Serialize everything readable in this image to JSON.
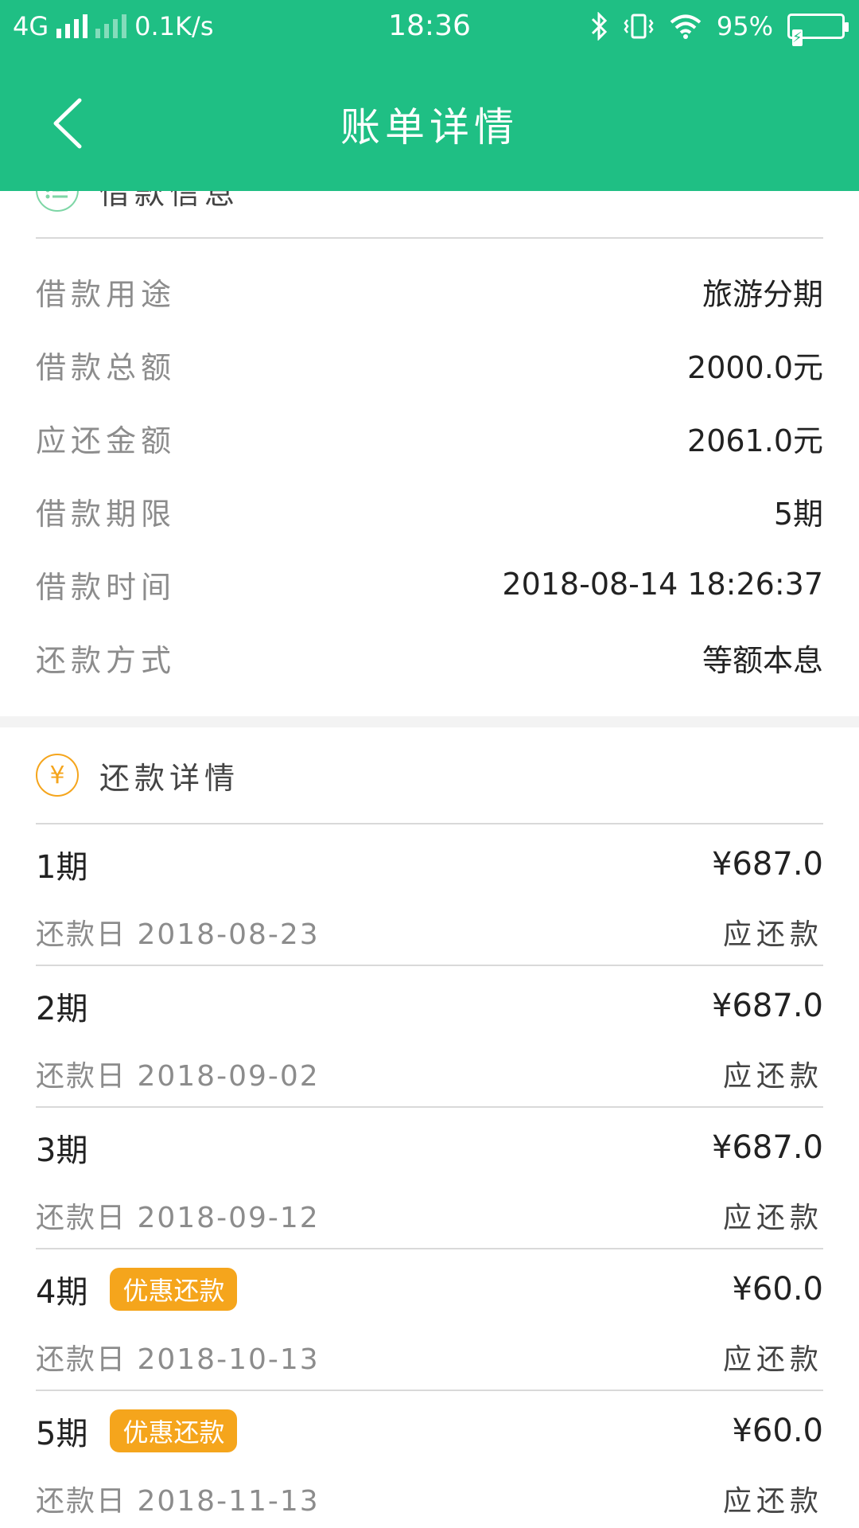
{
  "status_bar": {
    "network": "4G",
    "speed": "0.1K/s",
    "time": "18:36",
    "battery": "95%"
  },
  "nav": {
    "title": "账单详情"
  },
  "loan_info": {
    "title": "借款信息",
    "rows": [
      {
        "label": "借款用途",
        "value": "旅游分期"
      },
      {
        "label": "借款总额",
        "value": "2000.0元"
      },
      {
        "label": "应还金额",
        "value": "2061.0元"
      },
      {
        "label": "借款期限",
        "value": "5期"
      },
      {
        "label": "借款时间",
        "value": "2018-08-14 18:26:37"
      },
      {
        "label": "还款方式",
        "value": "等额本息"
      }
    ]
  },
  "repay": {
    "title": "还款详情",
    "icon_symbol": "¥",
    "date_prefix": "还款日",
    "terms": [
      {
        "name": "1期",
        "amount": "¥687.0",
        "date": "2018-08-23",
        "status": "应还款",
        "promo": ""
      },
      {
        "name": "2期",
        "amount": "¥687.0",
        "date": "2018-09-02",
        "status": "应还款",
        "promo": ""
      },
      {
        "name": "3期",
        "amount": "¥687.0",
        "date": "2018-09-12",
        "status": "应还款",
        "promo": ""
      },
      {
        "name": "4期",
        "amount": "¥60.0",
        "date": "2018-10-13",
        "status": "应还款",
        "promo": "优惠还款"
      },
      {
        "name": "5期",
        "amount": "¥60.0",
        "date": "2018-11-13",
        "status": "应还款",
        "promo": "优惠还款"
      }
    ]
  },
  "colors": {
    "brand_green": "#1fbf84",
    "list_icon": "#7ed6a6",
    "yen_icon": "#f5a51c",
    "promo_badge": "#f5a51c"
  }
}
